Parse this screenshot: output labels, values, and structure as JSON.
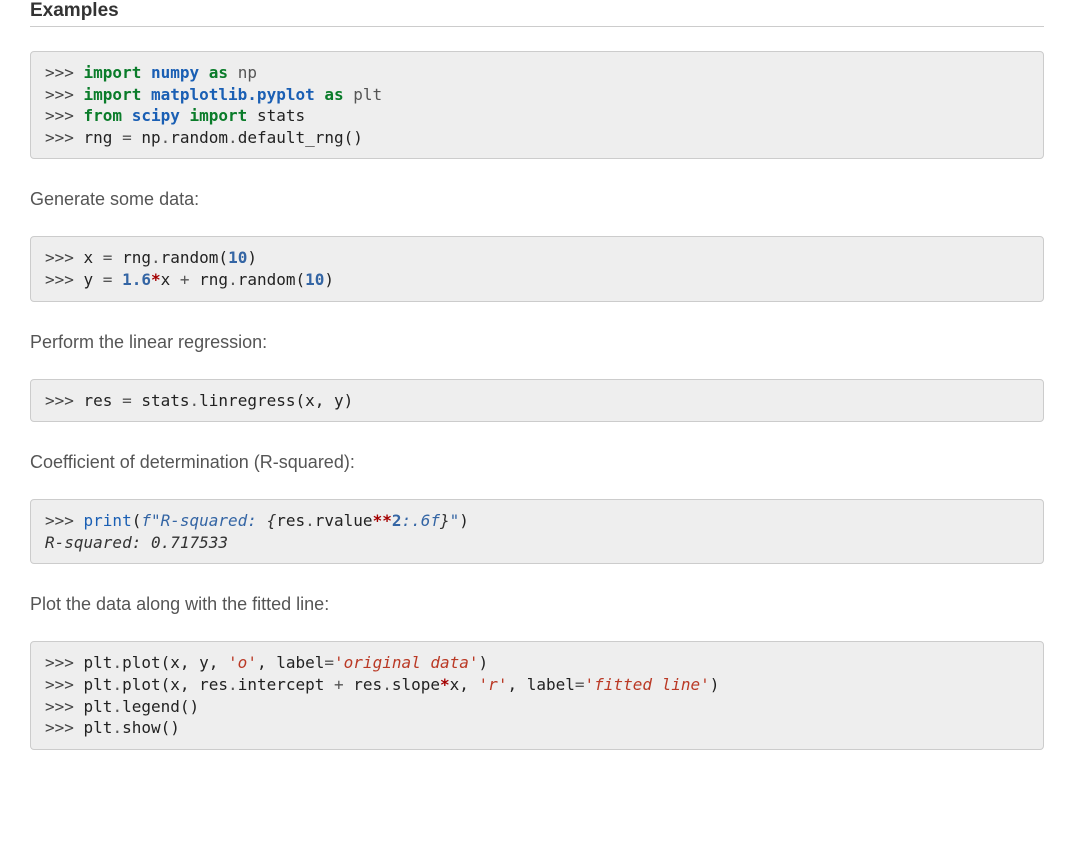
{
  "heading": "Examples",
  "block1": {
    "p1": ">>> ",
    "kw1": "import",
    "sp1": " ",
    "mod1": "numpy",
    "sp2": " ",
    "kw2": "as",
    "sp3": " ",
    "al1": "np",
    "nl1": "\n",
    "p2": ">>> ",
    "kw3": "import",
    "sp4": " ",
    "mod2": "matplotlib.pyplot",
    "sp5": " ",
    "kw4": "as",
    "sp6": " ",
    "al2": "plt",
    "nl2": "\n",
    "p3": ">>> ",
    "kw5": "from",
    "sp7": " ",
    "mod3": "scipy",
    "sp8": " ",
    "kw6": "import",
    "sp9": " ",
    "nm1": "stats",
    "nl3": "\n",
    "p4": ">>> ",
    "nm2": "rng ",
    "eq1": "=",
    "sp10": " ",
    "nm3": "np",
    "dot1": ".",
    "nm4": "random",
    "dot2": ".",
    "nm5": "default_rng",
    "par1": "()"
  },
  "desc1": "Generate some data:",
  "block2": {
    "p1": ">>> ",
    "nm1": "x ",
    "eq1": "=",
    "sp1": " ",
    "nm2": "rng",
    "dot1": ".",
    "nm3": "random",
    "par1": "(",
    "num1": "10",
    "par2": ")",
    "nl1": "\n",
    "p2": ">>> ",
    "nm4": "y ",
    "eq2": "=",
    "sp2": " ",
    "num2": "1.6",
    "star1": "*",
    "nm5": "x ",
    "plus1": "+ ",
    "nm6": "rng",
    "dot2": ".",
    "nm7": "random",
    "par3": "(",
    "num3": "10",
    "par4": ")"
  },
  "desc2": "Perform the linear regression:",
  "block3": {
    "p1": ">>> ",
    "nm1": "res ",
    "eq1": "=",
    "sp1": " ",
    "nm2": "stats",
    "dot1": ".",
    "nm3": "linregress",
    "par1": "(x, y)"
  },
  "desc3": "Coefficient of determination (R-squared):",
  "block4": {
    "p1": ">>> ",
    "fn1": "print",
    "par1": "(",
    "sp1": "f\"R-squared: ",
    "brace1": "{",
    "nm1": "res",
    "dot1": ".",
    "nm2": "rvalue",
    "pow1": "**",
    "num1": "2",
    "fmt": ":.6f",
    "brace2": "}",
    "sp2": "\"",
    "par2": ")",
    "nl1": "\n",
    "out1": "R-squared: 0.717533"
  },
  "desc4": "Plot the data along with the fitted line:",
  "block5": {
    "p1": ">>> ",
    "nm1": "plt",
    "dot1": ".",
    "nm2": "plot",
    "par1": "(x, y, ",
    "str1": "'o'",
    "nm3": ", label",
    "eq1": "=",
    "str2": "'original data'",
    "par2": ")",
    "nl1": "\n",
    "p2": ">>> ",
    "nm4": "plt",
    "dot2": ".",
    "nm5": "plot",
    "par3": "(x, res",
    "dot3": ".",
    "nm6": "intercept ",
    "plus1": "+ ",
    "nm7": "res",
    "dot4": ".",
    "nm8": "slope",
    "star1": "*",
    "nm9": "x, ",
    "str3": "'r'",
    "nm10": ", label",
    "eq2": "=",
    "str4": "'fitted line'",
    "par4": ")",
    "nl2": "\n",
    "p3": ">>> ",
    "nm11": "plt",
    "dot5": ".",
    "nm12": "legend",
    "par5": "()",
    "nl3": "\n",
    "p4": ">>> ",
    "nm13": "plt",
    "dot6": ".",
    "nm14": "show",
    "par6": "()"
  }
}
